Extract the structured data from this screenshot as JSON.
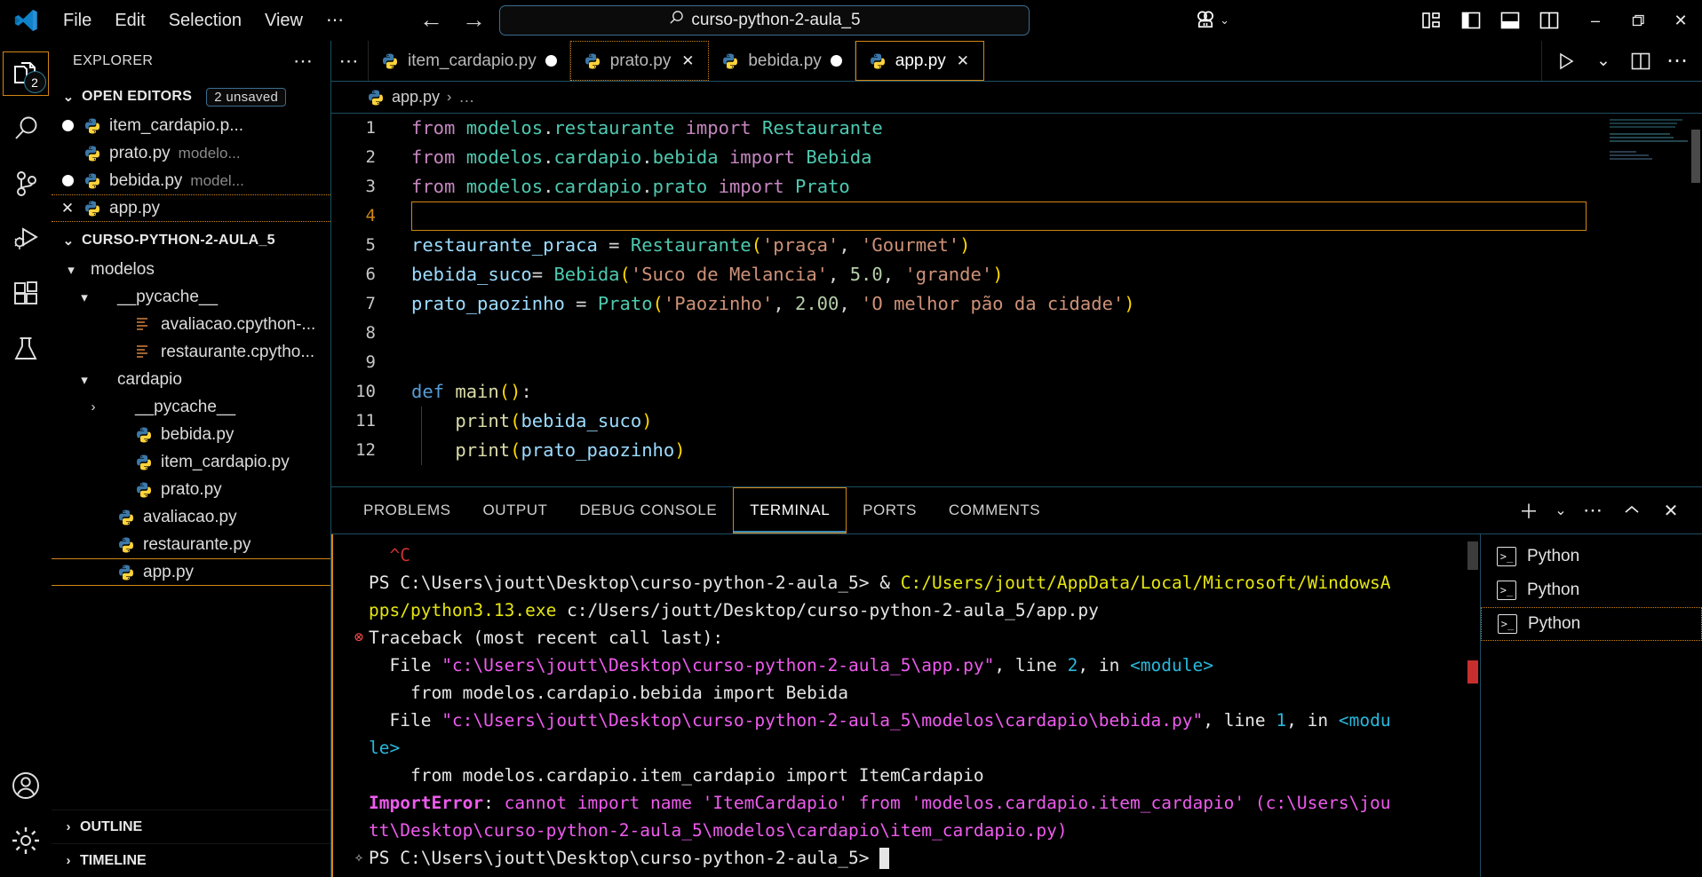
{
  "titlebar": {
    "menu": [
      "File",
      "Edit",
      "Selection",
      "View",
      "⋯"
    ],
    "nav_back": "←",
    "nav_forward": "→",
    "search_value": "curso-python-2-aula_5",
    "search_icon": "⌕",
    "account_chevron": "⌄",
    "layout_icons": [
      "customize-layout-icon",
      "toggle-primary-sidebar-icon",
      "toggle-panel-icon",
      "toggle-secondary-sidebar-icon"
    ],
    "window_minimize": "–",
    "window_restore": "❐",
    "window_close": "✕"
  },
  "activitybar": {
    "items": [
      {
        "name": "explorer",
        "badge": "2",
        "active": true
      },
      {
        "name": "search",
        "badge": "",
        "active": false
      },
      {
        "name": "source-control",
        "badge": "",
        "active": false
      },
      {
        "name": "run-and-debug",
        "badge": "",
        "active": false
      },
      {
        "name": "extensions",
        "badge": "",
        "active": false
      },
      {
        "name": "testing",
        "badge": "",
        "active": false
      }
    ],
    "bottom": [
      {
        "name": "accounts"
      },
      {
        "name": "settings"
      }
    ]
  },
  "sidebar": {
    "title": "EXPLORER",
    "more_actions": "⋯",
    "open_editors": {
      "label": "OPEN EDITORS",
      "badge": "2 unsaved",
      "chevron": "⌄",
      "items": [
        {
          "name": "item_cardapio.p...",
          "path": "",
          "dirty": true,
          "selected": false,
          "close": false
        },
        {
          "name": "prato.py",
          "path": "modelo...",
          "dirty": false,
          "selected": false,
          "close": false
        },
        {
          "name": "bebida.py",
          "path": "model...",
          "dirty": true,
          "selected": false,
          "close": false
        },
        {
          "name": "app.py",
          "path": "",
          "dirty": false,
          "selected": true,
          "close": true
        }
      ]
    },
    "project": {
      "label": "CURSO-PYTHON-2-AULA_5",
      "chevron": "⌄",
      "tree": [
        {
          "label": "modelos",
          "type": "folder",
          "expanded": true,
          "depth": 1
        },
        {
          "label": "__pycache__",
          "type": "folder",
          "expanded": true,
          "depth": 2
        },
        {
          "label": "avaliacao.cpython-...",
          "type": "cache",
          "expanded": false,
          "depth": 3
        },
        {
          "label": "restaurante.cpytho...",
          "type": "cache",
          "expanded": false,
          "depth": 3
        },
        {
          "label": "cardapio",
          "type": "folder",
          "expanded": true,
          "depth": 2
        },
        {
          "label": "__pycache__",
          "type": "folder",
          "expanded": false,
          "depth": 3
        },
        {
          "label": "bebida.py",
          "type": "python",
          "expanded": false,
          "depth": 3
        },
        {
          "label": "item_cardapio.py",
          "type": "python",
          "expanded": false,
          "depth": 3
        },
        {
          "label": "prato.py",
          "type": "python",
          "expanded": false,
          "depth": 3
        },
        {
          "label": "avaliacao.py",
          "type": "python",
          "expanded": false,
          "depth": 2
        },
        {
          "label": "restaurante.py",
          "type": "python",
          "expanded": false,
          "depth": 2
        },
        {
          "label": "app.py",
          "type": "python",
          "expanded": false,
          "depth": 1,
          "selected": true
        }
      ]
    },
    "outline": {
      "label": "OUTLINE",
      "chevron": "›"
    },
    "timeline": {
      "label": "TIMELINE",
      "chevron": "›"
    }
  },
  "editor": {
    "tab_overflow": "⋯",
    "tabs": [
      {
        "label": "item_cardapio.py",
        "dirty": true,
        "active": false,
        "focus": "none"
      },
      {
        "label": "prato.py",
        "dirty": false,
        "active": false,
        "focus": "dotted",
        "close": "✕"
      },
      {
        "label": "bebida.py",
        "dirty": true,
        "active": false,
        "focus": "none"
      },
      {
        "label": "app.py",
        "dirty": false,
        "active": true,
        "focus": "solid",
        "close": "✕"
      }
    ],
    "actions": [
      "run-python-file-icon",
      "run-chevron-icon",
      "split-editor-icon",
      "more-actions-icon"
    ],
    "run_chevron": "⌄",
    "more": "⋯",
    "breadcrumb": {
      "file": "app.py",
      "separator": "›",
      "rest": "…"
    },
    "current_line": 4,
    "lines": [
      {
        "n": 1,
        "tokens": [
          {
            "t": "from ",
            "c": "kw"
          },
          {
            "t": "modelos",
            "c": "cls"
          },
          {
            "t": ".",
            "c": "plain"
          },
          {
            "t": "restaurante ",
            "c": "cls"
          },
          {
            "t": "import ",
            "c": "kw"
          },
          {
            "t": "Restaurante",
            "c": "cls"
          }
        ]
      },
      {
        "n": 2,
        "tokens": [
          {
            "t": "from ",
            "c": "kw"
          },
          {
            "t": "modelos",
            "c": "cls"
          },
          {
            "t": ".",
            "c": "plain"
          },
          {
            "t": "cardapio",
            "c": "cls"
          },
          {
            "t": ".",
            "c": "plain"
          },
          {
            "t": "bebida ",
            "c": "cls"
          },
          {
            "t": "import ",
            "c": "kw"
          },
          {
            "t": "Bebida",
            "c": "cls"
          }
        ]
      },
      {
        "n": 3,
        "tokens": [
          {
            "t": "from ",
            "c": "kw"
          },
          {
            "t": "modelos",
            "c": "cls"
          },
          {
            "t": ".",
            "c": "plain"
          },
          {
            "t": "cardapio",
            "c": "cls"
          },
          {
            "t": ".",
            "c": "plain"
          },
          {
            "t": "prato ",
            "c": "cls"
          },
          {
            "t": "import ",
            "c": "kw"
          },
          {
            "t": "Prato",
            "c": "cls"
          }
        ]
      },
      {
        "n": 4,
        "tokens": []
      },
      {
        "n": 5,
        "tokens": [
          {
            "t": "restaurante_praca ",
            "c": "var"
          },
          {
            "t": "= ",
            "c": "plain"
          },
          {
            "t": "Restaurante",
            "c": "cls"
          },
          {
            "t": "(",
            "c": "par1"
          },
          {
            "t": "'praça'",
            "c": "str"
          },
          {
            "t": ", ",
            "c": "plain"
          },
          {
            "t": "'Gourmet'",
            "c": "str"
          },
          {
            "t": ")",
            "c": "par1"
          }
        ]
      },
      {
        "n": 6,
        "tokens": [
          {
            "t": "bebida_suco",
            "c": "var"
          },
          {
            "t": "= ",
            "c": "plain"
          },
          {
            "t": "Bebida",
            "c": "cls"
          },
          {
            "t": "(",
            "c": "par1"
          },
          {
            "t": "'Suco de Melancia'",
            "c": "str"
          },
          {
            "t": ", ",
            "c": "plain"
          },
          {
            "t": "5.0",
            "c": "num"
          },
          {
            "t": ", ",
            "c": "plain"
          },
          {
            "t": "'grande'",
            "c": "str"
          },
          {
            "t": ")",
            "c": "par1"
          }
        ]
      },
      {
        "n": 7,
        "tokens": [
          {
            "t": "prato_paozinho ",
            "c": "var"
          },
          {
            "t": "= ",
            "c": "plain"
          },
          {
            "t": "Prato",
            "c": "cls"
          },
          {
            "t": "(",
            "c": "par1"
          },
          {
            "t": "'Paozinho'",
            "c": "str"
          },
          {
            "t": ", ",
            "c": "plain"
          },
          {
            "t": "2.00",
            "c": "num"
          },
          {
            "t": ", ",
            "c": "plain"
          },
          {
            "t": "'O melhor pão da cidade'",
            "c": "str"
          },
          {
            "t": ")",
            "c": "par1"
          }
        ]
      },
      {
        "n": 8,
        "tokens": []
      },
      {
        "n": 9,
        "tokens": []
      },
      {
        "n": 10,
        "tokens": [
          {
            "t": "def ",
            "c": "kw2"
          },
          {
            "t": "main",
            "c": "fn"
          },
          {
            "t": "()",
            "c": "par1"
          },
          {
            "t": ":",
            "c": "plain"
          }
        ]
      },
      {
        "n": 11,
        "tokens": [
          {
            "t": "    ",
            "c": "plain"
          },
          {
            "t": "print",
            "c": "fn"
          },
          {
            "t": "(",
            "c": "par1"
          },
          {
            "t": "bebida_suco",
            "c": "var"
          },
          {
            "t": ")",
            "c": "par1"
          }
        ]
      },
      {
        "n": 12,
        "tokens": [
          {
            "t": "    ",
            "c": "plain"
          },
          {
            "t": "print",
            "c": "fn"
          },
          {
            "t": "(",
            "c": "par1"
          },
          {
            "t": "prato_paozinho",
            "c": "var"
          },
          {
            "t": ")",
            "c": "par1"
          }
        ]
      }
    ]
  },
  "panel": {
    "tabs": [
      {
        "label": "PROBLEMS",
        "active": false
      },
      {
        "label": "OUTPUT",
        "active": false
      },
      {
        "label": "DEBUG CONSOLE",
        "active": false
      },
      {
        "label": "TERMINAL",
        "active": true
      },
      {
        "label": "PORTS",
        "active": false
      },
      {
        "label": "COMMENTS",
        "active": false
      }
    ],
    "actions": {
      "new_terminal": "＋",
      "new_terminal_chevron": "⌄",
      "more": "⋯",
      "maximize": "⌃",
      "close": "✕"
    },
    "terminal_lines": [
      {
        "gutter": "",
        "parts": [
          {
            "t": "  ^C",
            "c": "t-red"
          }
        ]
      },
      {
        "gutter": "",
        "parts": [
          {
            "t": "PS C:\\Users\\joutt\\Desktop\\curso-python-2-aula_5> & ",
            "c": "t-white"
          },
          {
            "t": "C:/Users/joutt/AppData/Local/Microsoft/WindowsA",
            "c": "t-yellow"
          }
        ]
      },
      {
        "gutter": "",
        "parts": [
          {
            "t": "pps/python3.13.exe",
            "c": "t-yellow"
          },
          {
            "t": " c:/Users/joutt/Desktop/curso-python-2-aula_5/app.py",
            "c": "t-white"
          }
        ]
      },
      {
        "gutter": "⊗",
        "parts": [
          {
            "t": "Traceback (most recent call last):",
            "c": "t-white"
          }
        ]
      },
      {
        "gutter": "",
        "parts": [
          {
            "t": "  File ",
            "c": "t-white"
          },
          {
            "t": "\"c:\\Users\\joutt\\Desktop\\curso-python-2-aula_5\\app.py\"",
            "c": "t-magenta"
          },
          {
            "t": ", line ",
            "c": "t-white"
          },
          {
            "t": "2",
            "c": "t-cyan"
          },
          {
            "t": ", in ",
            "c": "t-white"
          },
          {
            "t": "<module>",
            "c": "t-cyan"
          }
        ]
      },
      {
        "gutter": "",
        "parts": [
          {
            "t": "    from modelos.cardapio.bebida import Bebida",
            "c": "t-white"
          }
        ]
      },
      {
        "gutter": "",
        "parts": [
          {
            "t": "  File ",
            "c": "t-white"
          },
          {
            "t": "\"c:\\Users\\joutt\\Desktop\\curso-python-2-aula_5\\modelos\\cardapio\\bebida.py\"",
            "c": "t-magenta"
          },
          {
            "t": ", line ",
            "c": "t-white"
          },
          {
            "t": "1",
            "c": "t-cyan"
          },
          {
            "t": ", in ",
            "c": "t-white"
          },
          {
            "t": "<modu",
            "c": "t-cyan"
          }
        ]
      },
      {
        "gutter": "",
        "parts": [
          {
            "t": "le>",
            "c": "t-cyan"
          }
        ]
      },
      {
        "gutter": "",
        "parts": [
          {
            "t": "    from modelos.cardapio.item_cardapio import ItemCardapio",
            "c": "t-white"
          }
        ]
      },
      {
        "gutter": "",
        "parts": [
          {
            "t": "ImportError",
            "c": "t-magenta-b"
          },
          {
            "t": ": ",
            "c": "t-white"
          },
          {
            "t": "cannot import name 'ItemCardapio' from 'modelos.cardapio.item_cardapio' (c:\\Users\\jou",
            "c": "t-magenta"
          }
        ]
      },
      {
        "gutter": "",
        "parts": [
          {
            "t": "tt\\Desktop\\curso-python-2-aula_5\\modelos\\cardapio\\item_cardapio.py)",
            "c": "t-magenta"
          }
        ]
      },
      {
        "gutter": "✧",
        "parts": [
          {
            "t": "PS C:\\Users\\joutt\\Desktop\\curso-python-2-aula_5> ",
            "c": "t-white"
          },
          {
            "t": "CURSOR",
            "c": "cursor"
          }
        ]
      }
    ],
    "terminal_list": [
      {
        "label": "Python",
        "icon": ">_",
        "selected": false
      },
      {
        "label": "Python",
        "icon": ">_",
        "selected": false
      },
      {
        "label": "Python",
        "icon": ">_",
        "selected": true
      }
    ]
  },
  "colors": {
    "accent_orange": "#d18616",
    "border_blue": "#1d4e63",
    "background": "#000000",
    "python_blue": "#3c78a8",
    "python_yellow": "#ffd43b"
  }
}
